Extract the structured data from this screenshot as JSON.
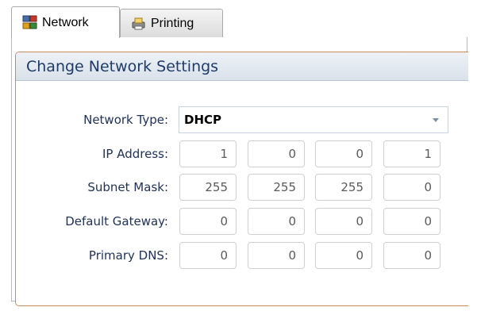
{
  "tabs": [
    {
      "label": "Network",
      "icon": "network-icon",
      "active": true
    },
    {
      "label": "Printing",
      "icon": "printer-icon",
      "active": false
    }
  ],
  "panel": {
    "title": "Change Network Settings",
    "fields": {
      "network_type": {
        "label": "Network Type:",
        "value": "DHCP"
      },
      "ip_address": {
        "label": "IP Address:",
        "octets": [
          "1",
          "0",
          "0",
          "1"
        ]
      },
      "subnet_mask": {
        "label": "Subnet Mask:",
        "octets": [
          "255",
          "255",
          "255",
          "0"
        ]
      },
      "default_gateway": {
        "label": "Default Gateway:",
        "octets": [
          "0",
          "0",
          "0",
          "0"
        ]
      },
      "primary_dns": {
        "label": "Primary DNS:",
        "octets": [
          "0",
          "0",
          "0",
          "0"
        ]
      }
    }
  },
  "colors": {
    "group_border": "#c98b55",
    "header_text": "#1f3b68",
    "label_text": "#203356"
  }
}
